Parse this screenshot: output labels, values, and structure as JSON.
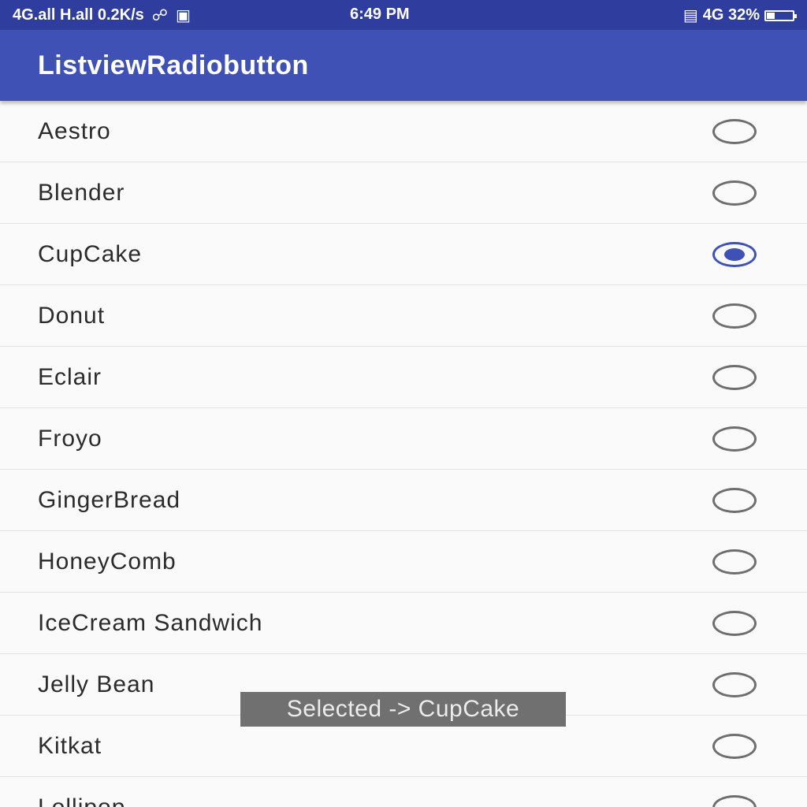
{
  "status_bar": {
    "left_text": "4G.all H.all 0.2K/s",
    "time": "6:49 PM",
    "right_text": "4G 32%",
    "battery_level": 0.32,
    "icons": [
      "signal-icon",
      "usb-icon",
      "notification-icon",
      "vibrate-icon",
      "battery-icon"
    ]
  },
  "app_bar": {
    "title": "ListviewRadiobutton"
  },
  "list": {
    "items": [
      {
        "label": "Aestro",
        "checked": false
      },
      {
        "label": "Blender",
        "checked": false
      },
      {
        "label": "CupCake",
        "checked": true
      },
      {
        "label": "Donut",
        "checked": false
      },
      {
        "label": "Eclair",
        "checked": false
      },
      {
        "label": "Froyo",
        "checked": false
      },
      {
        "label": "GingerBread",
        "checked": false
      },
      {
        "label": "HoneyComb",
        "checked": false
      },
      {
        "label": "IceCream Sandwich",
        "checked": false
      },
      {
        "label": "Jelly Bean",
        "checked": false
      },
      {
        "label": "Kitkat",
        "checked": false
      },
      {
        "label": "Lollipop",
        "checked": false
      }
    ]
  },
  "toast": {
    "text": "Selected -> CupCake"
  },
  "colors": {
    "status_bar": "#2f3e9e",
    "app_bar": "#3f51b5",
    "radio_checked": "#3f51b5",
    "radio_unchecked": "#6e6e6e",
    "toast_bg": "#707070"
  }
}
